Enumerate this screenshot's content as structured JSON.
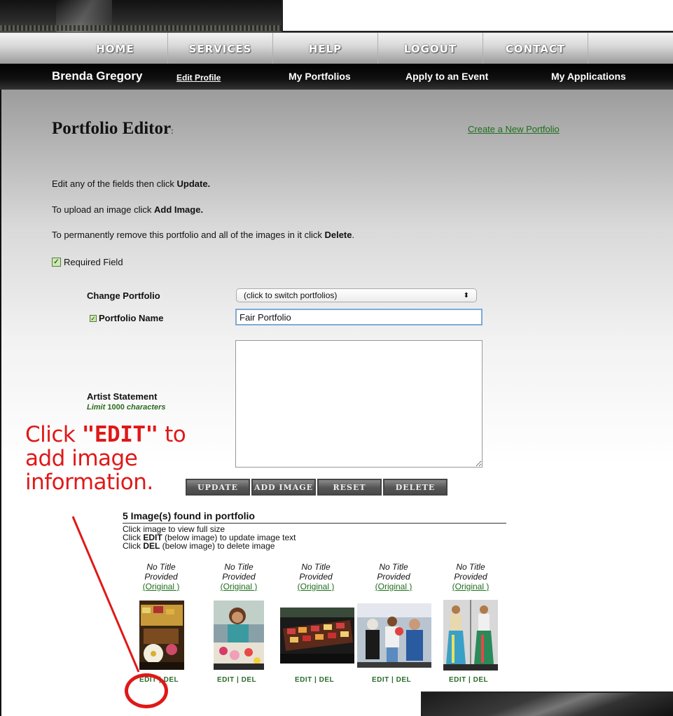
{
  "nav": {
    "items": [
      "HOME",
      "SERVICES",
      "HELP",
      "LOGOUT",
      "CONTACT"
    ]
  },
  "userbar": {
    "user_name": "Brenda Gregory",
    "edit_profile": "Edit Profile",
    "links": [
      "My Portfolios",
      "Apply to an Event",
      "My Applications"
    ]
  },
  "page": {
    "title": "Portfolio Editor",
    "title_colon": ":",
    "create_link": "Create a New Portfolio",
    "instructions": [
      {
        "pre": "Edit any of the fields then click ",
        "bold": "Update.",
        "post": ""
      },
      {
        "pre": "To upload an image click ",
        "bold": "Add Image.",
        "post": ""
      },
      {
        "pre": "To permanently remove this portfolio and all of the images in it click ",
        "bold": "Delete",
        "post": "."
      }
    ],
    "required_label": "Required Field",
    "check_glyph": "✓"
  },
  "form": {
    "change_portfolio_label": "Change Portfolio",
    "select_value": "(click to switch portfolios)",
    "select_arrow": "⬍",
    "portfolio_name_label": "Portfolio Name",
    "portfolio_name_value": "Fair Portfolio",
    "artist_statement_label": "Artist Statement",
    "limit_pre": "Limit ",
    "limit_num": "1000",
    "limit_post": " characters",
    "artist_statement_value": ""
  },
  "buttons": [
    "UPDATE",
    "ADD IMAGE",
    "RESET",
    "DELETE"
  ],
  "annotation": {
    "line1_pre": "Click ",
    "line1_bold": "\"EDIT\"",
    "line1_post": " to",
    "line2": "add image",
    "line3": "information."
  },
  "images": {
    "header": "5 Image(s) found in portfolio",
    "hints": [
      {
        "pre": "Click image to view full size",
        "bold": "",
        "post": ""
      },
      {
        "pre": "Click ",
        "bold": "EDIT",
        "post": " (below image) to update image text"
      },
      {
        "pre": "Click ",
        "bold": "DEL",
        "post": " (below image) to delete image"
      }
    ],
    "items": [
      {
        "title_1": "No Title",
        "title_2": "Provided",
        "original": "(Original )",
        "edit": "EDIT",
        "sep": " | ",
        "del": "DEL"
      },
      {
        "title_1": "No Title",
        "title_2": "Provided",
        "original": "(Original )",
        "edit": "EDIT",
        "sep": " | ",
        "del": "DEL"
      },
      {
        "title_1": "No Title",
        "title_2": "Provided",
        "original": "(Original )",
        "edit": "EDIT",
        "sep": " | ",
        "del": "DEL"
      },
      {
        "title_1": "No Title",
        "title_2": "Provided",
        "original": "(Original )",
        "edit": "EDIT",
        "sep": " | ",
        "del": "DEL"
      },
      {
        "title_1": "No Title",
        "title_2": "Provided",
        "original": "(Original )",
        "edit": "EDIT",
        "sep": " | ",
        "del": "DEL"
      }
    ]
  },
  "colors": {
    "link_green": "#1d6e1d",
    "annotation_red": "#e01818",
    "userbar_bg": "#000000"
  }
}
